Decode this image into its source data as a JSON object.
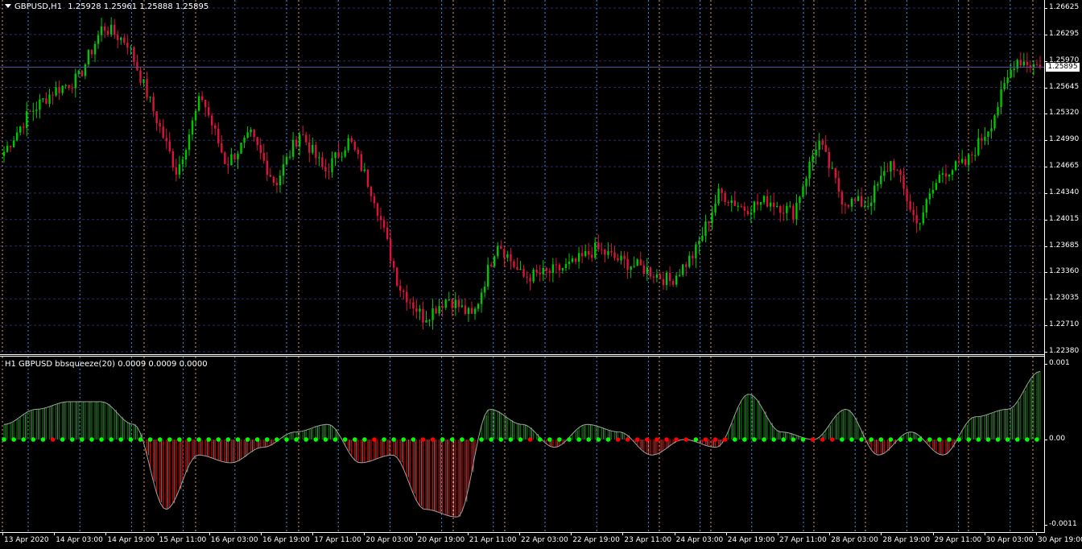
{
  "main_header": {
    "symbol": "GBPUSD,H1",
    "ohlc": "1.25928 1.25961 1.25888 1.25895"
  },
  "indicator_header": {
    "text": "H1 GBPUSD bbsqueeze(20) 0.0009 0.0009 0.0000"
  },
  "price_axis": {
    "labels": [
      "1.26625",
      "1.26295",
      "1.25970",
      "1.25645",
      "1.25320",
      "1.24990",
      "1.24665",
      "1.24340",
      "1.24015",
      "1.23685",
      "1.23360",
      "1.23035",
      "1.22710",
      "1.22380"
    ],
    "current_price": "1.25895"
  },
  "indicator_axis": {
    "labels": [
      "0.001",
      "0.00",
      "-0.0011"
    ]
  },
  "time_axis": {
    "labels": [
      "13 Apr 2020",
      "14 Apr 03:00",
      "14 Apr 19:00",
      "15 Apr 11:00",
      "16 Apr 03:00",
      "16 Apr 19:00",
      "17 Apr 11:00",
      "20 Apr 03:00",
      "20 Apr 19:00",
      "21 Apr 11:00",
      "22 Apr 03:00",
      "22 Apr 19:00",
      "23 Apr 11:00",
      "24 Apr 03:00",
      "24 Apr 19:00",
      "27 Apr 11:00",
      "28 Apr 03:00",
      "28 Apr 19:00",
      "29 Apr 11:00",
      "30 Apr 03:00",
      "30 Apr 19:00"
    ]
  },
  "colors": {
    "background": "#000000",
    "bull_candle": "#00c800",
    "bear_candle": "#dc143c",
    "grid": "#2a2a6e",
    "session_day_line": "#e0a060",
    "session_line": "#4a8fd8",
    "hist_green": "#007800",
    "hist_red": "#e00000",
    "dot_green": "#00ff00",
    "dot_red": "#ff0000"
  },
  "chart_data": [
    {
      "type": "candlestick",
      "symbol": "GBPUSD",
      "timeframe": "H1",
      "ylim": [
        1.2238,
        1.26625
      ],
      "x": [
        "13 Apr 2020",
        "14 Apr 03:00",
        "14 Apr 19:00",
        "15 Apr 11:00",
        "16 Apr 03:00",
        "16 Apr 19:00",
        "17 Apr 11:00",
        "20 Apr 03:00",
        "20 Apr 19:00",
        "21 Apr 11:00",
        "22 Apr 03:00",
        "22 Apr 19:00",
        "23 Apr 11:00",
        "24 Apr 03:00",
        "24 Apr 19:00",
        "27 Apr 11:00",
        "28 Apr 03:00",
        "28 Apr 19:00",
        "29 Apr 11:00",
        "30 Apr 03:00",
        "30 Apr 19:00"
      ],
      "close_path": [
        1.2485,
        1.2532,
        1.256,
        1.2575,
        1.264,
        1.262,
        1.254,
        1.246,
        1.2555,
        1.247,
        1.2505,
        1.2445,
        1.251,
        1.246,
        1.25,
        1.243,
        1.232,
        1.228,
        1.2305,
        1.228,
        1.2375,
        1.233,
        1.2335,
        1.2345,
        1.2365,
        1.235,
        1.234,
        1.2325,
        1.236,
        1.2435,
        1.2415,
        1.2425,
        1.241,
        1.25,
        1.2425,
        1.242,
        1.2475,
        1.2395,
        1.246,
        1.247,
        1.252,
        1.26,
        1.259
      ]
    },
    {
      "type": "histogram",
      "name": "bbsqueeze(20)",
      "ylim": [
        -0.0011,
        0.001
      ],
      "values_path": [
        0.0002,
        0.0004,
        0.0005,
        0.0005,
        0.0002,
        -0.0009,
        -0.0002,
        -0.0003,
        -0.0001,
        0.0001,
        0.0002,
        -0.0003,
        -0.0002,
        -0.0009,
        -0.001,
        0.0004,
        0.0002,
        -0.0001,
        0.0002,
        0.0001,
        -0.0002,
        0.0,
        -0.0001,
        0.0006,
        0.0001,
        0.0,
        0.0004,
        -0.0002,
        0.0001,
        -0.0002,
        0.0003,
        0.0004,
        0.0009
      ]
    }
  ]
}
